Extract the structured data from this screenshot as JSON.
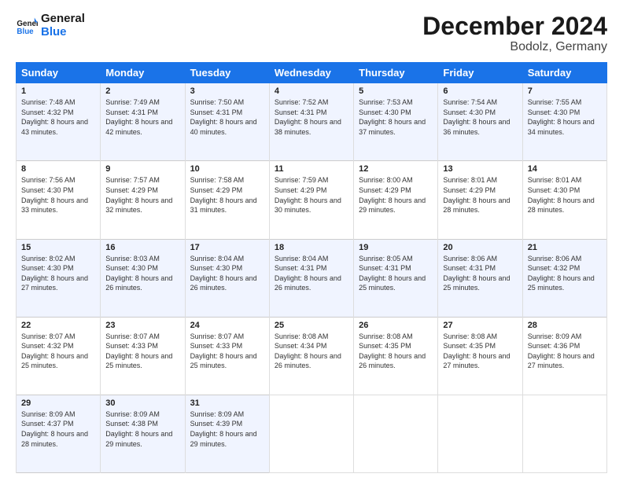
{
  "logo": {
    "line1": "General",
    "line2": "Blue"
  },
  "title": "December 2024",
  "subtitle": "Bodolz, Germany",
  "columns": [
    "Sunday",
    "Monday",
    "Tuesday",
    "Wednesday",
    "Thursday",
    "Friday",
    "Saturday"
  ],
  "weeks": [
    [
      {
        "day": "1",
        "sunrise": "7:48 AM",
        "sunset": "4:32 PM",
        "daylight": "8 hours and 43 minutes."
      },
      {
        "day": "2",
        "sunrise": "7:49 AM",
        "sunset": "4:31 PM",
        "daylight": "8 hours and 42 minutes."
      },
      {
        "day": "3",
        "sunrise": "7:50 AM",
        "sunset": "4:31 PM",
        "daylight": "8 hours and 40 minutes."
      },
      {
        "day": "4",
        "sunrise": "7:52 AM",
        "sunset": "4:31 PM",
        "daylight": "8 hours and 38 minutes."
      },
      {
        "day": "5",
        "sunrise": "7:53 AM",
        "sunset": "4:30 PM",
        "daylight": "8 hours and 37 minutes."
      },
      {
        "day": "6",
        "sunrise": "7:54 AM",
        "sunset": "4:30 PM",
        "daylight": "8 hours and 36 minutes."
      },
      {
        "day": "7",
        "sunrise": "7:55 AM",
        "sunset": "4:30 PM",
        "daylight": "8 hours and 34 minutes."
      }
    ],
    [
      {
        "day": "8",
        "sunrise": "7:56 AM",
        "sunset": "4:30 PM",
        "daylight": "8 hours and 33 minutes."
      },
      {
        "day": "9",
        "sunrise": "7:57 AM",
        "sunset": "4:29 PM",
        "daylight": "8 hours and 32 minutes."
      },
      {
        "day": "10",
        "sunrise": "7:58 AM",
        "sunset": "4:29 PM",
        "daylight": "8 hours and 31 minutes."
      },
      {
        "day": "11",
        "sunrise": "7:59 AM",
        "sunset": "4:29 PM",
        "daylight": "8 hours and 30 minutes."
      },
      {
        "day": "12",
        "sunrise": "8:00 AM",
        "sunset": "4:29 PM",
        "daylight": "8 hours and 29 minutes."
      },
      {
        "day": "13",
        "sunrise": "8:01 AM",
        "sunset": "4:29 PM",
        "daylight": "8 hours and 28 minutes."
      },
      {
        "day": "14",
        "sunrise": "8:01 AM",
        "sunset": "4:30 PM",
        "daylight": "8 hours and 28 minutes."
      }
    ],
    [
      {
        "day": "15",
        "sunrise": "8:02 AM",
        "sunset": "4:30 PM",
        "daylight": "8 hours and 27 minutes."
      },
      {
        "day": "16",
        "sunrise": "8:03 AM",
        "sunset": "4:30 PM",
        "daylight": "8 hours and 26 minutes."
      },
      {
        "day": "17",
        "sunrise": "8:04 AM",
        "sunset": "4:30 PM",
        "daylight": "8 hours and 26 minutes."
      },
      {
        "day": "18",
        "sunrise": "8:04 AM",
        "sunset": "4:31 PM",
        "daylight": "8 hours and 26 minutes."
      },
      {
        "day": "19",
        "sunrise": "8:05 AM",
        "sunset": "4:31 PM",
        "daylight": "8 hours and 25 minutes."
      },
      {
        "day": "20",
        "sunrise": "8:06 AM",
        "sunset": "4:31 PM",
        "daylight": "8 hours and 25 minutes."
      },
      {
        "day": "21",
        "sunrise": "8:06 AM",
        "sunset": "4:32 PM",
        "daylight": "8 hours and 25 minutes."
      }
    ],
    [
      {
        "day": "22",
        "sunrise": "8:07 AM",
        "sunset": "4:32 PM",
        "daylight": "8 hours and 25 minutes."
      },
      {
        "day": "23",
        "sunrise": "8:07 AM",
        "sunset": "4:33 PM",
        "daylight": "8 hours and 25 minutes."
      },
      {
        "day": "24",
        "sunrise": "8:07 AM",
        "sunset": "4:33 PM",
        "daylight": "8 hours and 25 minutes."
      },
      {
        "day": "25",
        "sunrise": "8:08 AM",
        "sunset": "4:34 PM",
        "daylight": "8 hours and 26 minutes."
      },
      {
        "day": "26",
        "sunrise": "8:08 AM",
        "sunset": "4:35 PM",
        "daylight": "8 hours and 26 minutes."
      },
      {
        "day": "27",
        "sunrise": "8:08 AM",
        "sunset": "4:35 PM",
        "daylight": "8 hours and 27 minutes."
      },
      {
        "day": "28",
        "sunrise": "8:09 AM",
        "sunset": "4:36 PM",
        "daylight": "8 hours and 27 minutes."
      }
    ],
    [
      {
        "day": "29",
        "sunrise": "8:09 AM",
        "sunset": "4:37 PM",
        "daylight": "8 hours and 28 minutes."
      },
      {
        "day": "30",
        "sunrise": "8:09 AM",
        "sunset": "4:38 PM",
        "daylight": "8 hours and 29 minutes."
      },
      {
        "day": "31",
        "sunrise": "8:09 AM",
        "sunset": "4:39 PM",
        "daylight": "8 hours and 29 minutes."
      },
      null,
      null,
      null,
      null
    ]
  ]
}
